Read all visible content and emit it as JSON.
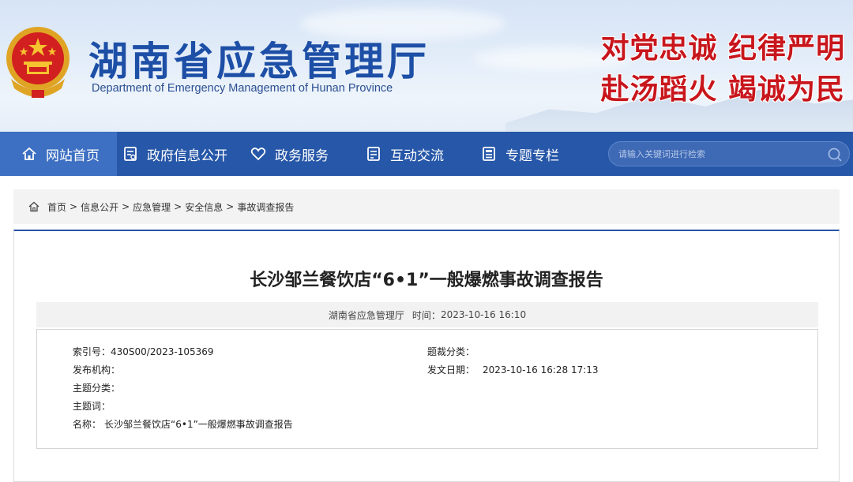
{
  "header": {
    "title": "湖南省应急管理厅",
    "subtitle": "Department of Emergency Management of Hunan Province",
    "slogan_line1": "对党忠诚  纪律严明",
    "slogan_line2": "赴汤蹈火  竭诚为民",
    "emblem_icon": "national-emblem-icon",
    "colors": {
      "title": "#1d4fa6",
      "slogan": "#c8161d",
      "nav": "#2757a8"
    }
  },
  "nav": {
    "items": [
      {
        "label": "网站首页",
        "icon": "home-icon",
        "active": true
      },
      {
        "label": "政府信息公开",
        "icon": "document-icon",
        "active": false
      },
      {
        "label": "政务服务",
        "icon": "heart-icon",
        "active": false
      },
      {
        "label": "互动交流",
        "icon": "chat-document-icon",
        "active": false
      },
      {
        "label": "专题专栏",
        "icon": "list-document-icon",
        "active": false
      }
    ],
    "search": {
      "placeholder": "请输入关键词进行检索",
      "icon": "search-icon"
    }
  },
  "breadcrumb": {
    "icon": "home-icon",
    "items": [
      "首页",
      "信息公开",
      "应急管理",
      "安全信息",
      "事故调查报告"
    ],
    "separator": ">"
  },
  "article": {
    "title": "长沙邹兰餐饮店“6•1”一般爆燃事故调查报告",
    "source": "湖南省应急管理厅",
    "time_label": "时间：",
    "time_value": "2023-10-16 16:10",
    "info": {
      "index_label": "索引号：",
      "index_value": "430S00/2023-105369",
      "publisher_label": "发布机构：",
      "publisher_value": "",
      "topic_label": "主题分类：",
      "topic_value": "",
      "keywords_label": "主题词：",
      "keywords_value": "",
      "name_label": "名称：",
      "name_value": "长沙邹兰餐饮店“6•1”一般爆燃事故调查报告",
      "genre_label": "题裁分类：",
      "genre_value": "",
      "date_label": "发文日期：",
      "date_value": "2023-10-16 16:28 17:13"
    }
  }
}
